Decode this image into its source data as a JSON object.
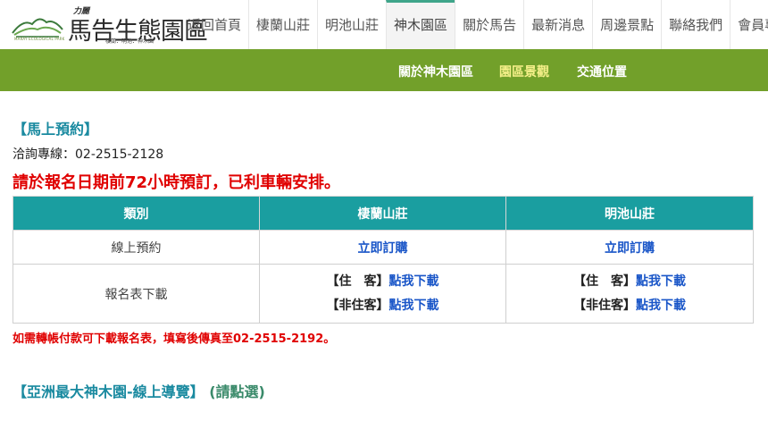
{
  "header": {
    "logo": {
      "top_text": "力麗",
      "title": "馬告生態園區",
      "small_text": "MARAY ECOLOGICAL PARK",
      "tagline": "棲蘭．明池．神木園"
    },
    "nav": [
      {
        "label": "返回首頁"
      },
      {
        "label": "棲蘭山莊"
      },
      {
        "label": "明池山莊"
      },
      {
        "label": "神木園區",
        "active": true
      },
      {
        "label": "關於馬告"
      },
      {
        "label": "最新消息"
      },
      {
        "label": "周邊景點"
      },
      {
        "label": "聯絡我們"
      },
      {
        "label": "會員專區"
      }
    ]
  },
  "subnav": [
    {
      "label": "關於神木園區"
    },
    {
      "label": "園區景觀",
      "active": true
    },
    {
      "label": "交通位置"
    }
  ],
  "content": {
    "section_title": "【馬上預約】",
    "hotline": "洽詢專線：02-2515-2128",
    "notice": "請於報名日期前72小時預訂，已利車輛安排。",
    "table": {
      "headers": [
        "類別",
        "棲蘭山莊",
        "明池山莊"
      ],
      "online_label": "線上預約",
      "buy_now": "立即訂購",
      "form_label": "報名表下載",
      "guest_label": "【住　客】",
      "non_guest_label": "【非住客】",
      "download": "點我下載"
    },
    "transfer_note": "如需轉帳付款可下載報名表，填寫後傳真至02-2515-2192。",
    "tour_title": "【亞洲最大神木園-線上導覽】",
    "tour_link": "(請點選)"
  },
  "colors": {
    "accent_green": "#72a02a",
    "teal": "#1a9ea0",
    "alert_red": "#e00000",
    "link_blue": "#1a56c8"
  }
}
